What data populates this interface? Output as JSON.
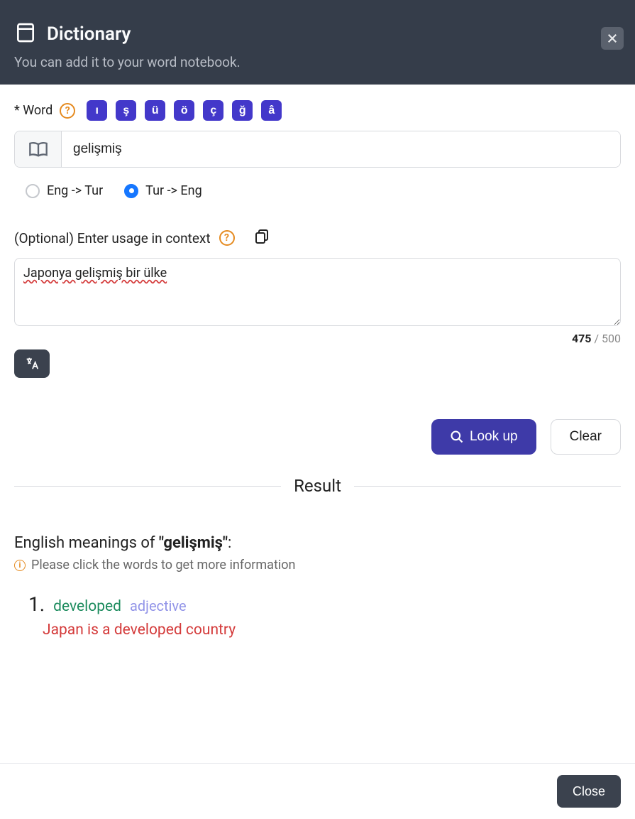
{
  "header": {
    "title": "Dictionary",
    "subtitle": "You can add it to your word notebook."
  },
  "wordSection": {
    "label": "* Word",
    "specialChars": [
      "ı",
      "ş",
      "ü",
      "ö",
      "ç",
      "ğ",
      "â"
    ],
    "input": "gelişmiş"
  },
  "direction": {
    "option1": "Eng -> Tur",
    "option2": "Tur -> Eng",
    "selected": "option2"
  },
  "context": {
    "label": "(Optional) Enter usage in context",
    "text": "Japonya gelişmiş bir ülke",
    "used": "475",
    "max": " / 500"
  },
  "actions": {
    "lookup": "Look up",
    "clear": "Clear"
  },
  "result": {
    "heading": "Result",
    "titlePrefix": "English meanings of ",
    "titleWord": "\"gelişmiş\"",
    "titleSuffix": ":",
    "hint": "Please click the words to get more information",
    "meanings": [
      {
        "num": "1.",
        "word": "developed",
        "pos": "adjective"
      }
    ],
    "example": "Japan is a developed country"
  },
  "footer": {
    "close": "Close"
  }
}
